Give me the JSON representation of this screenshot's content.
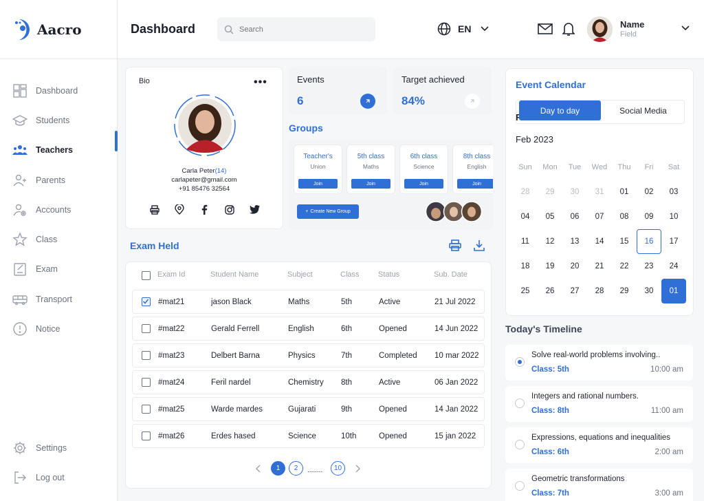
{
  "app": {
    "name": "Aacro"
  },
  "sidebar": {
    "items": [
      {
        "label": "Dashboard",
        "icon": "dashboard-icon"
      },
      {
        "label": "Students",
        "icon": "graduation-cap-icon"
      },
      {
        "label": "Teachers",
        "icon": "group-icon",
        "active": true
      },
      {
        "label": "Parents",
        "icon": "parents-icon"
      },
      {
        "label": "Accounts",
        "icon": "account-settings-icon"
      },
      {
        "label": "Class",
        "icon": "star-icon"
      },
      {
        "label": "Exam",
        "icon": "exam-icon"
      },
      {
        "label": "Transport",
        "icon": "bus-icon"
      },
      {
        "label": "Notice",
        "icon": "notice-icon"
      }
    ],
    "bottom": [
      {
        "label": "Settings",
        "icon": "gear-icon"
      },
      {
        "label": "Log out",
        "icon": "logout-icon"
      }
    ]
  },
  "header": {
    "title": "Dashboard",
    "search_placeholder": "Search",
    "language": "EN",
    "user": {
      "name": "Name",
      "role": "Field"
    }
  },
  "bio": {
    "label": "Bio",
    "name": "Carla Peter",
    "count": "(14)",
    "email": "carlapeter@gmail.com",
    "phone": "+91 85476 32564"
  },
  "stats": {
    "events": {
      "label": "Events",
      "value": "6"
    },
    "target": {
      "label": "Target achieved",
      "value": "84%"
    }
  },
  "groups": {
    "title": "Groups",
    "items": [
      {
        "title": "Teacher's",
        "sub": "Union",
        "button": "Join"
      },
      {
        "title": "5th class",
        "sub": "Maths",
        "button": "Join"
      },
      {
        "title": "6th class",
        "sub": "Science",
        "button": "Join"
      },
      {
        "title": "8th class",
        "sub": "English",
        "button": "Join"
      }
    ],
    "create_label": "Create New Group"
  },
  "exam": {
    "title": "Exam Held",
    "columns": [
      "Exam Id",
      "Student Name",
      "Subject",
      "Class",
      "Status",
      "Sub. Date"
    ],
    "rows": [
      {
        "id": "#mat21",
        "name": "jason Black",
        "subject": "Maths",
        "class": "5th",
        "status": "Active",
        "date": "21 Jul 2022",
        "checked": true
      },
      {
        "id": "#mat22",
        "name": "Gerald Ferrell",
        "subject": "English",
        "class": "6th",
        "status": "Opened",
        "date": "14 Jun 2022",
        "checked": false
      },
      {
        "id": "#mat23",
        "name": "Delbert Barna",
        "subject": "Physics",
        "class": "7th",
        "status": "Completed",
        "date": "10 mar 2022",
        "checked": false
      },
      {
        "id": "#mat24",
        "name": "Feril nardel",
        "subject": "Chemistry",
        "class": "8th",
        "status": "Active",
        "date": "06 Jan 2022",
        "checked": false
      },
      {
        "id": "#mat25",
        "name": "Warde mardes",
        "subject": "Gujarati",
        "class": "9th",
        "status": "Opened",
        "date": "14 Jan 2022",
        "checked": false
      },
      {
        "id": "#mat26",
        "name": "Erdes hased",
        "subject": "Science",
        "class": "10th",
        "status": "Opened",
        "date": "15 jan 2022",
        "checked": false
      }
    ],
    "pagination": {
      "pages": [
        "1",
        "2",
        "10"
      ],
      "ellipsis": "........",
      "current": "1"
    }
  },
  "calendar": {
    "title": "Event Calendar",
    "tabs": [
      "Day to day",
      "Social Media"
    ],
    "month": "Feb 2023",
    "weekdays": [
      "Sun",
      "Mon",
      "Tue",
      "Wed",
      "Thu",
      "Fri",
      "Sat"
    ],
    "weeks": [
      [
        "28",
        "29",
        "30",
        "31",
        "01",
        "02",
        "03"
      ],
      [
        "04",
        "05",
        "06",
        "07",
        "08",
        "09",
        "10"
      ],
      [
        "11",
        "12",
        "13",
        "14",
        "15",
        "16",
        "17"
      ],
      [
        "18",
        "19",
        "20",
        "21",
        "22",
        "23",
        "24"
      ],
      [
        "25",
        "26",
        "27",
        "28",
        "29",
        "30",
        "01"
      ]
    ]
  },
  "timeline": {
    "title": "Today's Timeline",
    "items": [
      {
        "title": "Solve real-world problems involving..",
        "class": "Class: 5th",
        "time": "10:00 am"
      },
      {
        "title": "Integers and rational numbers.",
        "class": "Class: 8th",
        "time": "11:00 am"
      },
      {
        "title": "Expressions, equations and inequalities",
        "class": "Class: 6th",
        "time": "2:00 am"
      },
      {
        "title": "Geometric transformations",
        "class": "Class: 7th",
        "time": "3:00 am"
      }
    ]
  },
  "colors": {
    "accent": "#2f6fd6",
    "background": "#f6f7f9"
  }
}
